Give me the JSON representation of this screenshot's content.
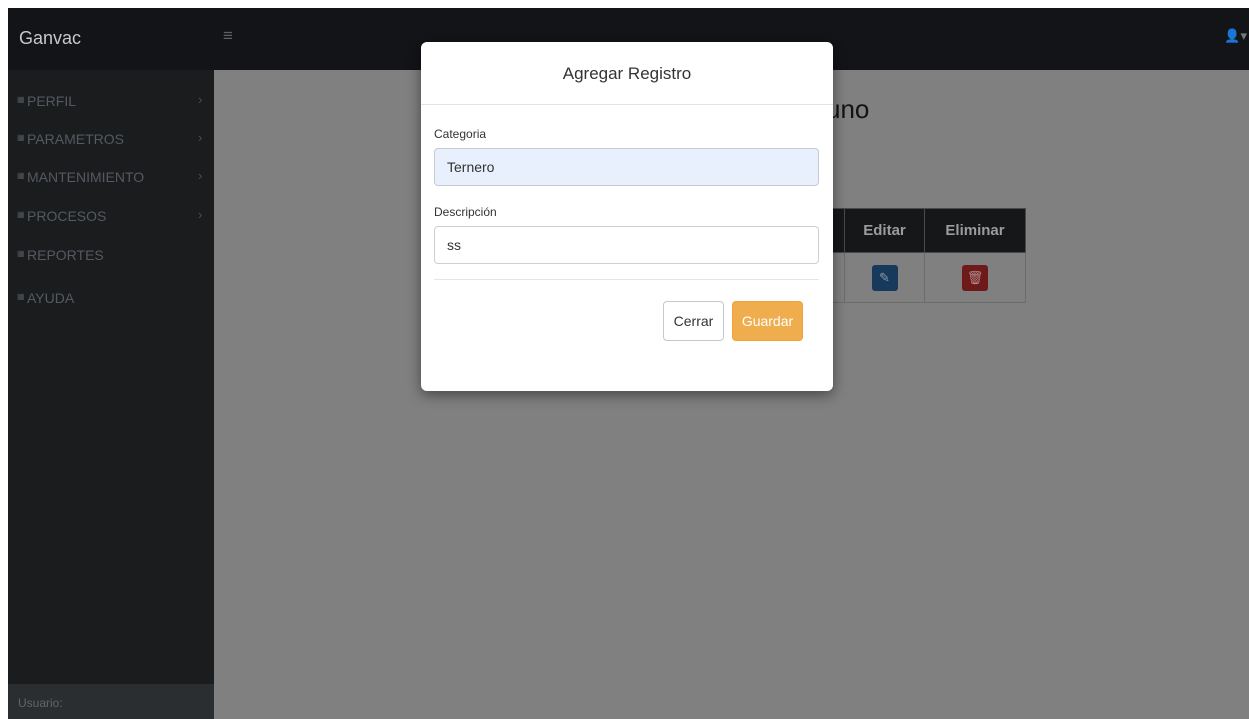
{
  "app": {
    "brand": "Ganvac",
    "menu_toggle_icon": "hamburger-icon",
    "user_icon": "user-icon",
    "user_caret": "▾"
  },
  "sidebar": {
    "items": [
      {
        "label": "PERFIL",
        "icon": "list-icon",
        "has_arrow": true
      },
      {
        "label": "PARAMETROS",
        "icon": "list-icon",
        "has_arrow": true
      },
      {
        "label": "MANTENIMIENTO",
        "icon": "list-icon",
        "has_arrow": true
      },
      {
        "label": "PROCESOS",
        "icon": "list-icon",
        "has_arrow": true
      },
      {
        "label": "REPORTES",
        "icon": "list-icon",
        "has_arrow": false
      },
      {
        "label": "AYUDA",
        "icon": "list-icon",
        "has_arrow": false
      }
    ],
    "footer": "Usuario:"
  },
  "page": {
    "title_fragment": "uno",
    "table": {
      "headers": {
        "editar": "Editar",
        "eliminar": "Eliminar"
      }
    }
  },
  "modal": {
    "title": "Agregar Registro",
    "categoria": {
      "label": "Categoria",
      "value": "Ternero"
    },
    "descripcion": {
      "label": "Descripción",
      "value": "ss"
    },
    "buttons": {
      "cerrar": "Cerrar",
      "guardar": "Guardar"
    }
  },
  "colors": {
    "accent_warning": "#f0ad4e",
    "edit_button": "#17395c",
    "delete_button": "#6e1a1a",
    "sidebar": "#1a1c1e"
  }
}
